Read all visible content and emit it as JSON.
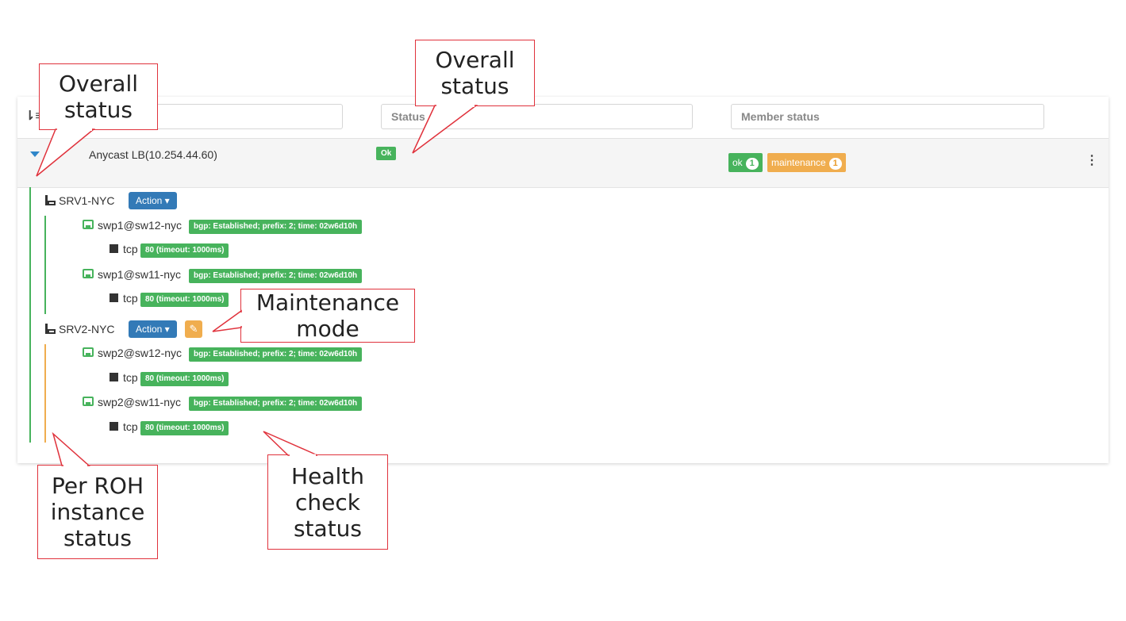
{
  "filters": {
    "name_placeholder": "",
    "status_placeholder": "Status",
    "member_placeholder": "Member status"
  },
  "lb": {
    "name": "Anycast LB(10.254.44.60)",
    "status": "Ok",
    "member_status": [
      {
        "label": "ok",
        "count": "1",
        "color": "#47b35c"
      },
      {
        "label": "maintenance",
        "count": "1",
        "color": "#f0ad4e"
      }
    ]
  },
  "servers": [
    {
      "name": "SRV1-NYC",
      "action_label": "Action ▾",
      "maintenance": false,
      "members": [
        {
          "name": "swp1@sw12-nyc",
          "bgp": "bgp: Established; prefix: 2; time: 02w6d10h",
          "check_name": "tcp",
          "check_status": "80 (timeout: 1000ms)"
        },
        {
          "name": "swp1@sw11-nyc",
          "bgp": "bgp: Established; prefix: 2; time: 02w6d10h",
          "check_name": "tcp",
          "check_status": "80 (timeout: 1000ms)"
        }
      ]
    },
    {
      "name": "SRV2-NYC",
      "action_label": "Action ▾",
      "maintenance": true,
      "members": [
        {
          "name": "swp2@sw12-nyc",
          "bgp": "bgp: Established; prefix: 2; time: 02w6d10h",
          "check_name": "tcp",
          "check_status": "80 (timeout: 1000ms)"
        },
        {
          "name": "swp2@sw11-nyc",
          "bgp": "bgp: Established; prefix: 2; time: 02w6d10h",
          "check_name": "tcp",
          "check_status": "80 (timeout: 1000ms)"
        }
      ]
    }
  ],
  "callouts": {
    "overall_left": "Overall status",
    "overall_top": "Overall status",
    "maintenance": "Maintenance mode",
    "per_roh": "Per ROH instance status",
    "health": "Health check status"
  },
  "icons": {
    "sort": "sort-icon",
    "caret": "caret-down-icon",
    "server": "server-icon",
    "interface": "interface-icon",
    "check": "square-icon",
    "wrench": "wrench-icon",
    "kebab": "kebab-menu-icon"
  },
  "colors": {
    "ok": "#47b35c",
    "maintenance": "#f0ad4e",
    "action": "#337ab7",
    "callout_border": "#e0323c"
  }
}
